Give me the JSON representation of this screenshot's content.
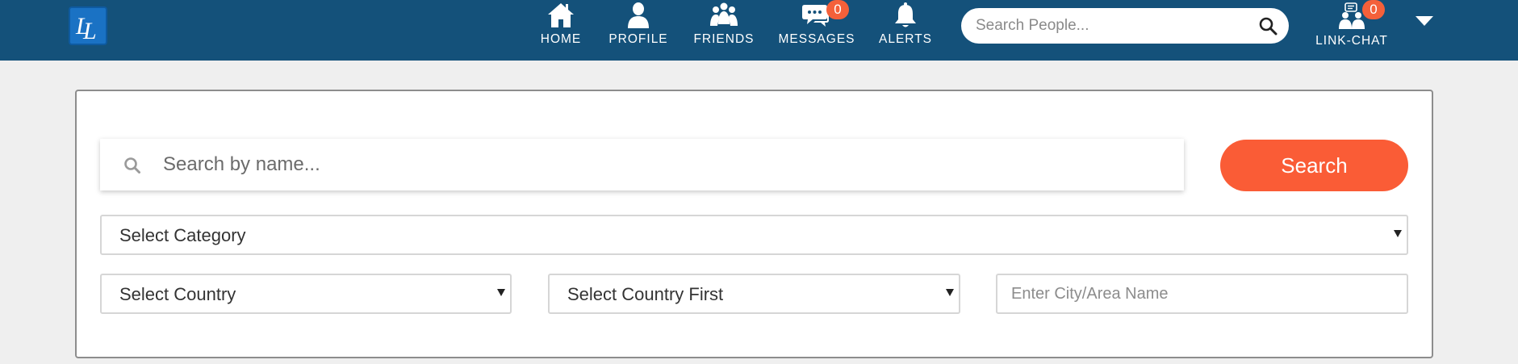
{
  "header": {
    "logo_text": "LL",
    "nav": [
      {
        "label": "HOME",
        "icon": "home-icon"
      },
      {
        "label": "PROFILE",
        "icon": "user-icon"
      },
      {
        "label": "FRIENDS",
        "icon": "friends-icon"
      },
      {
        "label": "MESSAGES",
        "icon": "messages-icon",
        "badge": "0"
      },
      {
        "label": "ALERTS",
        "icon": "bell-icon"
      }
    ],
    "search": {
      "placeholder": "Search People...",
      "icon": "search-icon"
    },
    "chat": {
      "label": "LINK-CHAT",
      "icon": "chat-group-icon",
      "badge": "0"
    },
    "menu_icon": "caret-down-icon"
  },
  "search_panel": {
    "name_search": {
      "placeholder": "Search by name...",
      "icon": "search-icon"
    },
    "search_button": "Search",
    "category_select": "Select Category",
    "country_select": "Select Country",
    "state_select": "Select Country First",
    "city_input": {
      "placeholder": "Enter City/Area Name"
    }
  },
  "colors": {
    "header_bg": "#14517a",
    "accent": "#fa5c36",
    "badge": "#f4603a",
    "page_bg": "#efefef"
  }
}
